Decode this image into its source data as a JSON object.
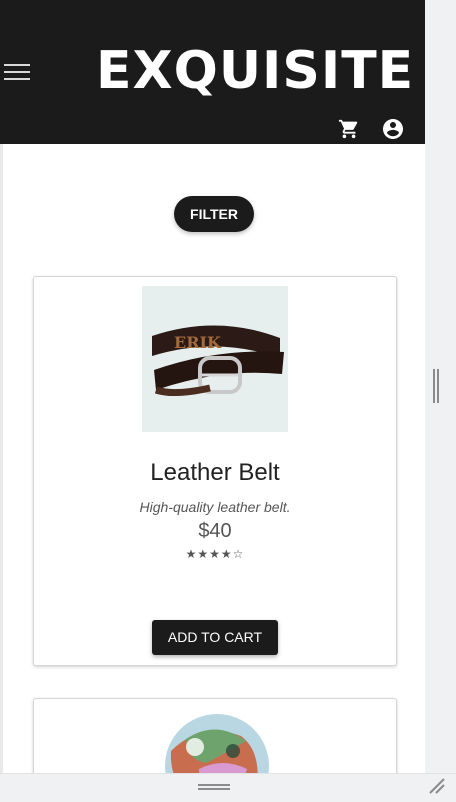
{
  "header": {
    "brand": "EXQUISITE",
    "icons": {
      "menu": "menu-icon",
      "cart": "shopping-cart-icon",
      "account": "account-circle-icon"
    }
  },
  "filter": {
    "label": "FILTER"
  },
  "products": [
    {
      "title": "Leather Belt",
      "description": "High-quality leather belt.",
      "price": "$40",
      "rating_text": "★★★★☆",
      "rating": 4,
      "rating_max": 5,
      "button_label": "ADD TO CART",
      "image": "leather-belt-image"
    },
    {
      "image": "scarf-image"
    }
  ],
  "colors": {
    "header_bg": "#1b1b1b",
    "accent": "#1b1b1b",
    "background": "#ffffff"
  }
}
